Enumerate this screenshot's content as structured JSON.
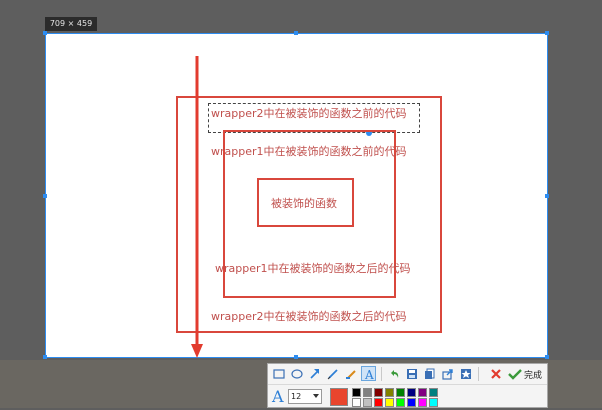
{
  "size_readout": "709 × 459",
  "canvas": {
    "labels": {
      "w2_before": "wrapper2中在被装饰的函数之前的代码",
      "w1_before": "wrapper1中在被装饰的函数之前的代码",
      "inner": "被装饰的函数",
      "w1_after": "wrapper1中在被装饰的函数之后的代码",
      "w2_after": "wrapper2中在被装饰的函数之后的代码"
    }
  },
  "toolbar": {
    "done_label": "完成",
    "font_size": "12",
    "current_color": "#e8452d",
    "tools": [
      "rectangle-tool",
      "ellipse-tool",
      "arrow-tool",
      "pen-tool",
      "mosaic-tool",
      "text-tool",
      "undo",
      "save",
      "copy",
      "share",
      "pin",
      "cancel",
      "done"
    ],
    "palette": [
      "#000000",
      "#808080",
      "#800000",
      "#808000",
      "#008000",
      "#000080",
      "#800080",
      "#008080",
      "#ffffff",
      "#c0c0c0",
      "#ff0000",
      "#ffff00",
      "#00ff00",
      "#0000ff",
      "#ff00ff",
      "#00ffff"
    ]
  },
  "colors": {
    "annotation": "#c0504d",
    "selection": "#2d8cf0"
  }
}
